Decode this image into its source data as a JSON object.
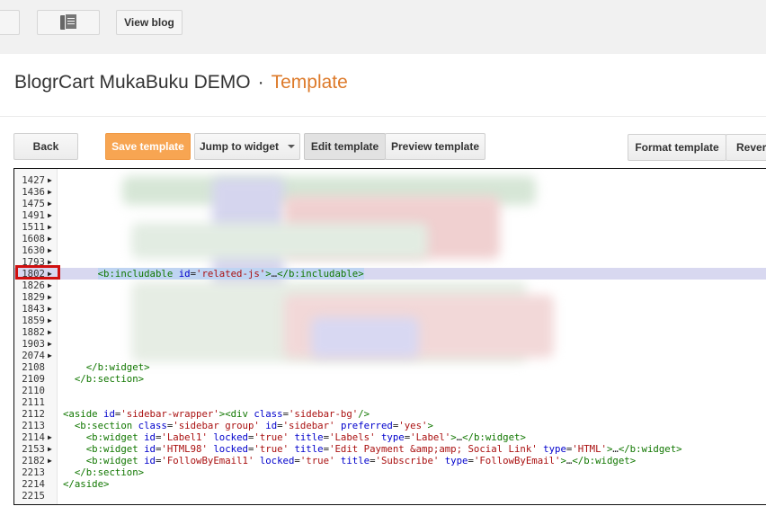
{
  "topbar": {
    "view_blog_label": "View blog"
  },
  "header": {
    "blog_name": "BlogrCart MukaBuku DEMO",
    "separator": "·",
    "section": "Template"
  },
  "toolbar": {
    "back_label": "Back",
    "save_label": "Save template",
    "jump_label": "Jump to widget",
    "edit_label": "Edit template",
    "preview_label": "Preview template",
    "format_label": "Format template",
    "revert_label": "Revert",
    "save_color": "#f7a552"
  },
  "editor": {
    "lines": [
      {
        "num": "1427",
        "fold": true,
        "code": ""
      },
      {
        "num": "1436",
        "fold": true,
        "code": ""
      },
      {
        "num": "1475",
        "fold": true,
        "code": ""
      },
      {
        "num": "1491",
        "fold": true,
        "code": ""
      },
      {
        "num": "1511",
        "fold": true,
        "code": ""
      },
      {
        "num": "1608",
        "fold": true,
        "code": ""
      },
      {
        "num": "1630",
        "fold": true,
        "code": ""
      },
      {
        "num": "1793",
        "fold": true,
        "code": ""
      },
      {
        "num": "1802",
        "fold": true,
        "code": "      <b:includable id='related-js'>…</b:includable>"
      },
      {
        "num": "1826",
        "fold": true,
        "code": ""
      },
      {
        "num": "1829",
        "fold": true,
        "code": ""
      },
      {
        "num": "1843",
        "fold": true,
        "code": ""
      },
      {
        "num": "1859",
        "fold": true,
        "code": ""
      },
      {
        "num": "1882",
        "fold": true,
        "code": ""
      },
      {
        "num": "1903",
        "fold": true,
        "code": ""
      },
      {
        "num": "2074",
        "fold": true,
        "code": ""
      },
      {
        "num": "2108",
        "fold": false,
        "code": "    </b:widget>"
      },
      {
        "num": "2109",
        "fold": false,
        "code": "  </b:section>"
      },
      {
        "num": "2110",
        "fold": false,
        "code": ""
      },
      {
        "num": "2111",
        "fold": false,
        "code": ""
      },
      {
        "num": "2112",
        "fold": false,
        "code": "<aside id='sidebar-wrapper'><div class='sidebar-bg'/>"
      },
      {
        "num": "2113",
        "fold": false,
        "code": "  <b:section class='sidebar group' id='sidebar' preferred='yes'>"
      },
      {
        "num": "2114",
        "fold": true,
        "code": "    <b:widget id='Label1' locked='true' title='Labels' type='Label'>…</b:widget>"
      },
      {
        "num": "2153",
        "fold": true,
        "code": "    <b:widget id='HTML98' locked='true' title='Edit Payment &amp;amp; Social Link' type='HTML'>…</b:widget>"
      },
      {
        "num": "2182",
        "fold": true,
        "code": "    <b:widget id='FollowByEmail1' locked='true' title='Subscribe' type='FollowByEmail'>…</b:widget>"
      },
      {
        "num": "2213",
        "fold": false,
        "code": "  </b:section>"
      },
      {
        "num": "2214",
        "fold": false,
        "code": "</aside>"
      },
      {
        "num": "2215",
        "fold": false,
        "code": ""
      }
    ],
    "highlighted_line": "1802"
  }
}
